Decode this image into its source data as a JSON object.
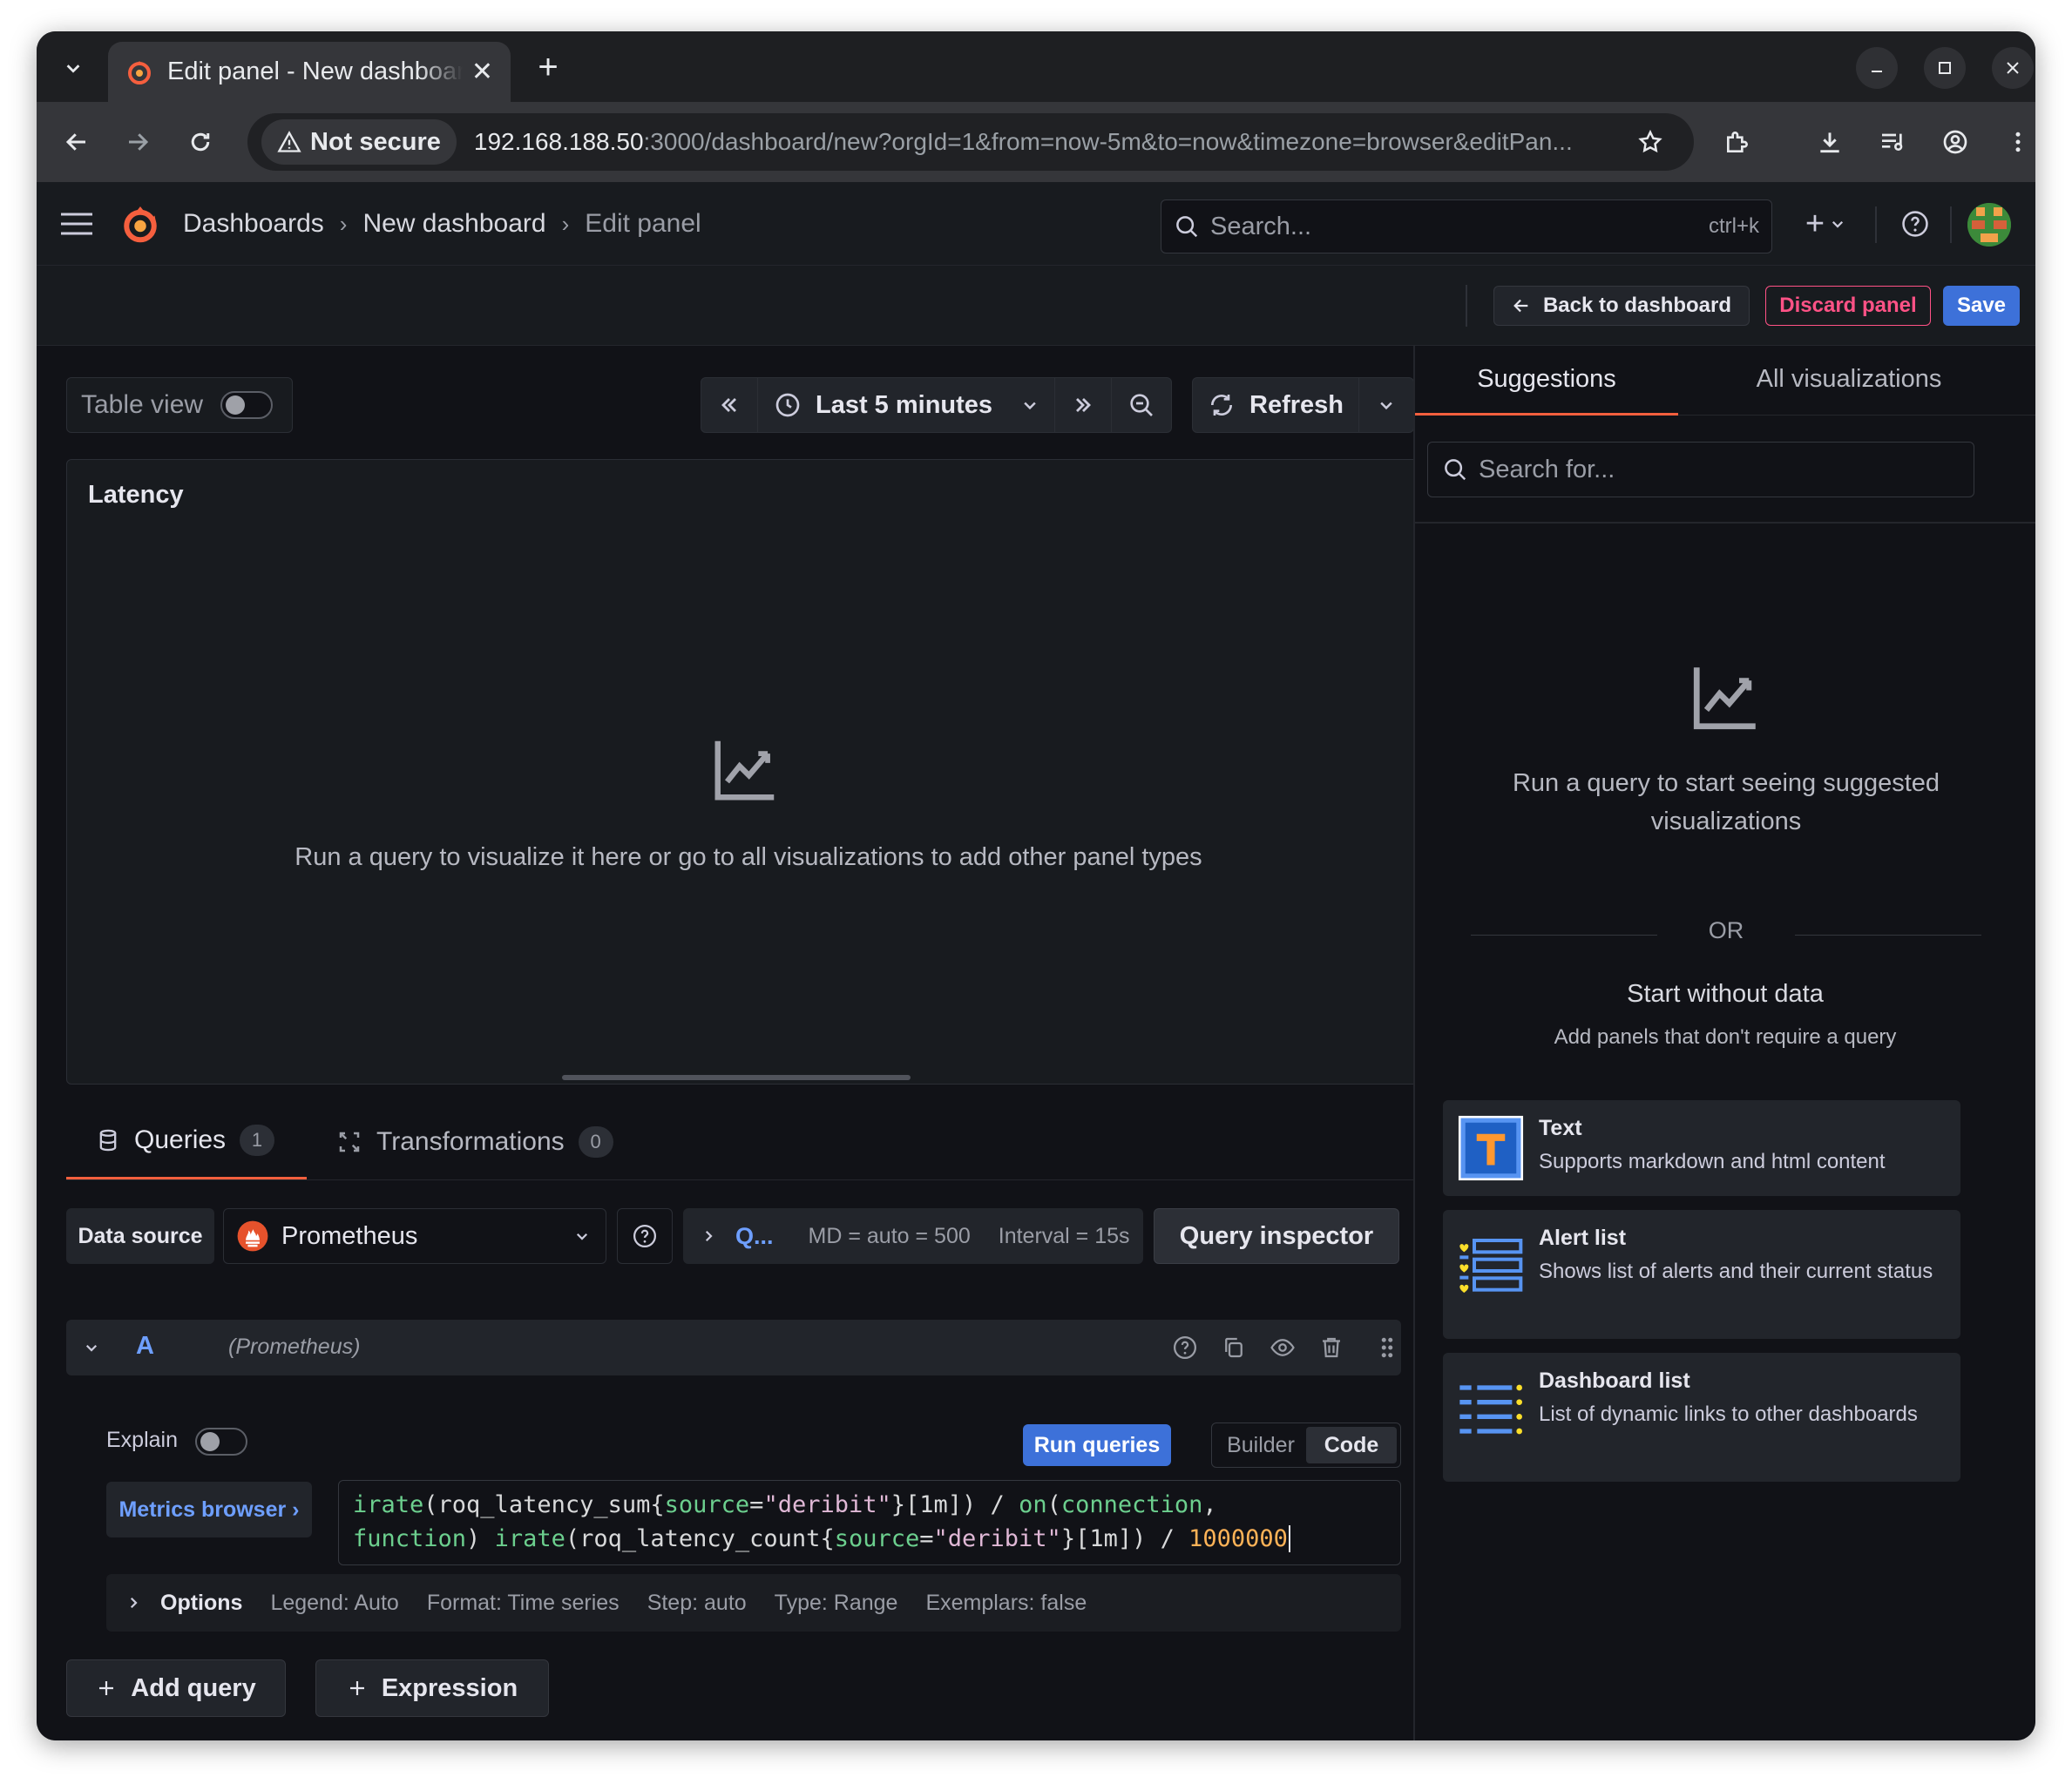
{
  "browser": {
    "tab_title": "Edit panel - New dashboard",
    "tab_close": "✕",
    "new_tab": "+",
    "not_secure": "Not secure",
    "url_host": "192.168.188.50",
    "url_rest": ":3000/dashboard/new?orgId=1&from=now-5m&to=now&timezone=browser&editPan..."
  },
  "topnav": {
    "breadcrumbs": [
      "Dashboards",
      "New dashboard",
      "Edit panel"
    ],
    "search_placeholder": "Search...",
    "search_shortcut": "ctrl+k",
    "add_label": "+"
  },
  "toolbar": {
    "back": "Back to dashboard",
    "discard": "Discard panel",
    "save": "Save"
  },
  "panel_controls": {
    "table_view": "Table view",
    "time_range": "Last 5 minutes",
    "refresh": "Refresh"
  },
  "panel": {
    "title": "Latency",
    "empty_message": "Run a query to visualize it here or go to all visualizations to add other panel types"
  },
  "query_tabs": [
    {
      "label": "Queries",
      "count": "1"
    },
    {
      "label": "Transformations",
      "count": "0"
    }
  ],
  "datasource": {
    "label": "Data source",
    "name": "Prometheus",
    "query_options_short": "Q...",
    "md": "MD = auto = 500",
    "interval": "Interval = 15s",
    "inspector": "Query inspector"
  },
  "query": {
    "ref": "A",
    "datasource_hint": "(Prometheus)",
    "explain": "Explain",
    "run": "Run queries",
    "builder": "Builder",
    "code": "Code",
    "metrics_browser": "Metrics browser ›",
    "options_label": "Options",
    "options_summary": [
      "Legend: Auto",
      "Format: Time series",
      "Step: auto",
      "Type: Range",
      "Exemplars: false"
    ]
  },
  "add_buttons": {
    "add_query": "Add query",
    "expression": "Expression"
  },
  "sidebar": {
    "tabs": [
      "Suggestions",
      "All visualizations"
    ],
    "search_placeholder": "Search for...",
    "empty_title": "Run a query to start seeing suggested visualizations",
    "or": "OR",
    "start_without": "Start without data",
    "start_hint": "Add panels that don't require a query",
    "cards": [
      {
        "title": "Text",
        "desc": "Supports markdown and html content"
      },
      {
        "title": "Alert list",
        "desc": "Shows list of alerts and their current status"
      },
      {
        "title": "Dashboard list",
        "desc": "List of dynamic links to other dashboards"
      }
    ]
  },
  "colors": {
    "primary": "#3d71d9",
    "danger": "#ff5286",
    "accent_orange": "#f55f3e",
    "background": "#111217"
  }
}
